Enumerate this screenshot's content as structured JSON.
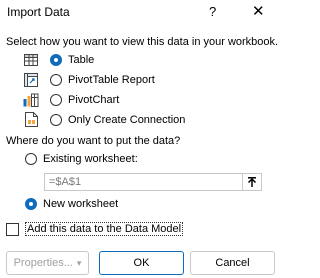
{
  "window": {
    "title": "Import Data",
    "help_label": "?",
    "close_label": "✕"
  },
  "view_section": {
    "prompt": "Select how you want to view this data in your workbook.",
    "options": [
      {
        "label": "Table",
        "selected": true,
        "icon": "table-icon"
      },
      {
        "label": "PivotTable Report",
        "selected": false,
        "icon": "pivottable-icon"
      },
      {
        "label": "PivotChart",
        "selected": false,
        "icon": "pivotchart-icon"
      },
      {
        "label": "Only Create Connection",
        "selected": false,
        "icon": "connection-icon"
      }
    ]
  },
  "location_section": {
    "prompt": "Where do you want to put the data?",
    "existing_label": "Existing worksheet:",
    "existing_selected": false,
    "reference_value": "=$A$1",
    "collapse_icon": "collapse-dialog-icon",
    "new_label": "New worksheet",
    "new_selected": true
  },
  "data_model": {
    "label": "Add this data to the Data Model",
    "checked": false
  },
  "buttons": {
    "properties_label": "Properties...",
    "properties_caret": "▾",
    "ok_label": "OK",
    "cancel_label": "Cancel"
  },
  "colors": {
    "accent": "#0f6cbd",
    "border": "#c8c8c8",
    "disabled_text": "#a0a0a0"
  }
}
